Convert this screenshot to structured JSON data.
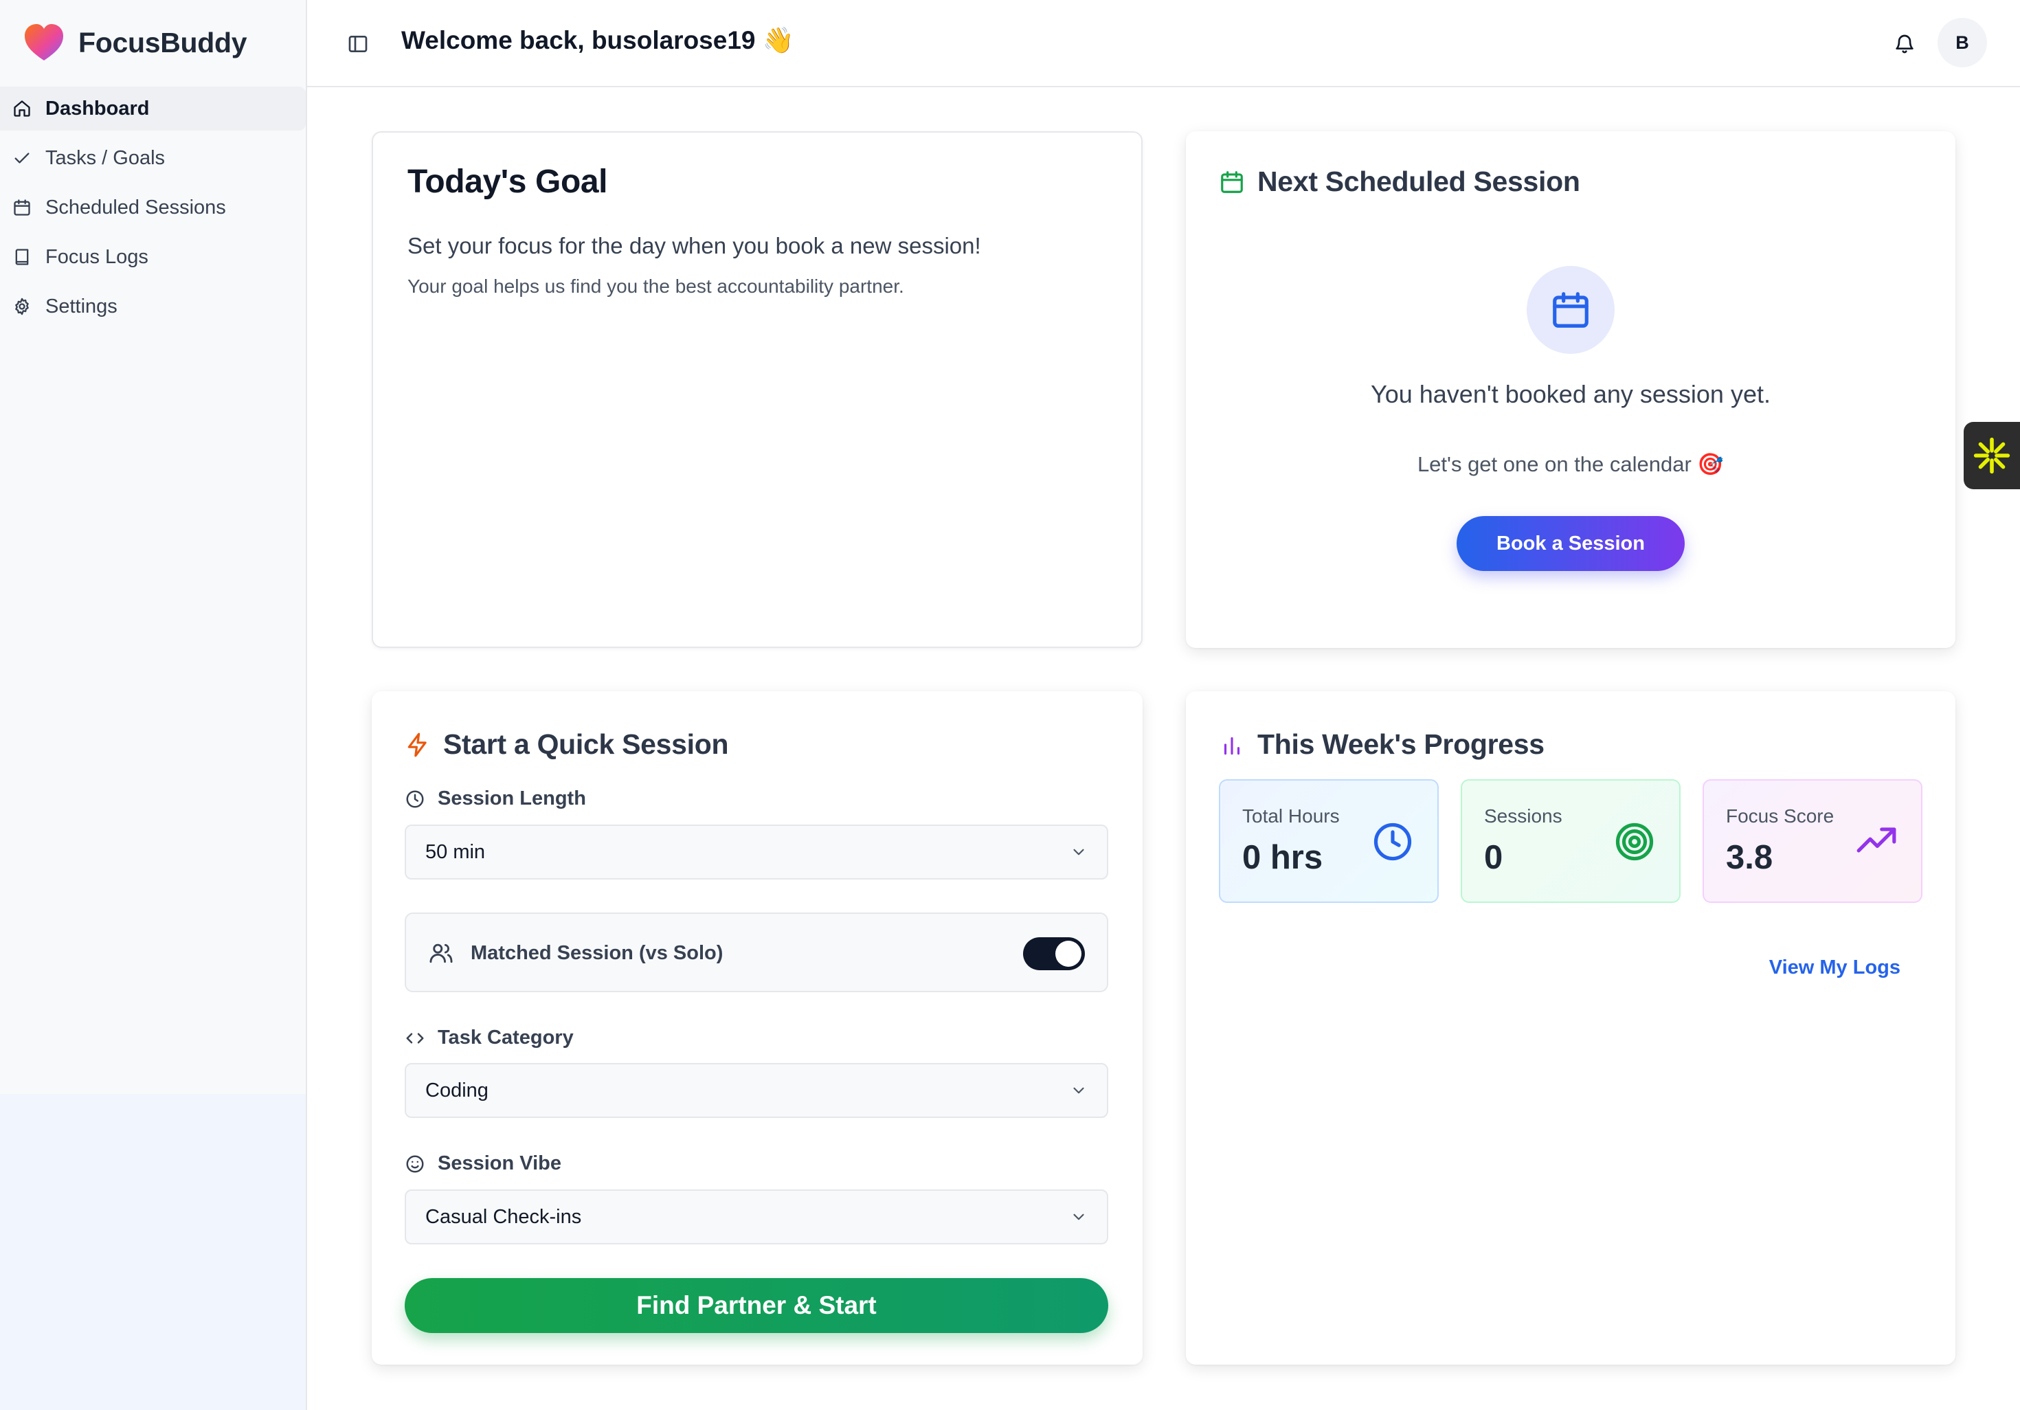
{
  "app": {
    "name": "FocusBuddy"
  },
  "sidebar": {
    "items": [
      {
        "label": "Dashboard",
        "icon": "home-icon",
        "active": true
      },
      {
        "label": "Tasks / Goals",
        "icon": "check-icon"
      },
      {
        "label": "Scheduled Sessions",
        "icon": "calendar-icon"
      },
      {
        "label": "Focus Logs",
        "icon": "book-icon"
      },
      {
        "label": "Settings",
        "icon": "gear-icon"
      }
    ]
  },
  "header": {
    "welcome": "Welcome back, busolarose19 👋",
    "avatar_initial": "B"
  },
  "todays_goal": {
    "title": "Today's Goal",
    "line1": "Set your focus for the day when you book a new session!",
    "line2": "Your goal helps us find you the best accountability partner."
  },
  "next_session": {
    "title": "Next Scheduled Session",
    "empty_message": "You haven't booked any session yet.",
    "empty_sub": "Let's get one on the calendar 🎯",
    "button": "Book a Session"
  },
  "quick_session": {
    "title": "Start a Quick Session",
    "length_label": "Session Length",
    "length_value": "50 min",
    "matched_label": "Matched Session (vs Solo)",
    "matched_on": true,
    "category_label": "Task Category",
    "category_value": "Coding",
    "vibe_label": "Session Vibe",
    "vibe_value": "Casual Check-ins",
    "button": "Find Partner & Start"
  },
  "progress": {
    "title": "This Week's Progress",
    "stats": [
      {
        "label": "Total Hours",
        "value": "0 hrs",
        "icon": "clock-icon",
        "color": "#2563eb"
      },
      {
        "label": "Sessions",
        "value": "0",
        "icon": "target-icon",
        "color": "#16a34a"
      },
      {
        "label": "Focus Score",
        "value": "3.8",
        "icon": "trending-up-icon",
        "color": "#9333ea"
      }
    ],
    "link": "View My Logs"
  },
  "colors": {
    "accent_blue": "#2563eb",
    "accent_purple": "#7c3aed",
    "accent_green": "#16a34a",
    "quick_icon": "#ea580c"
  }
}
